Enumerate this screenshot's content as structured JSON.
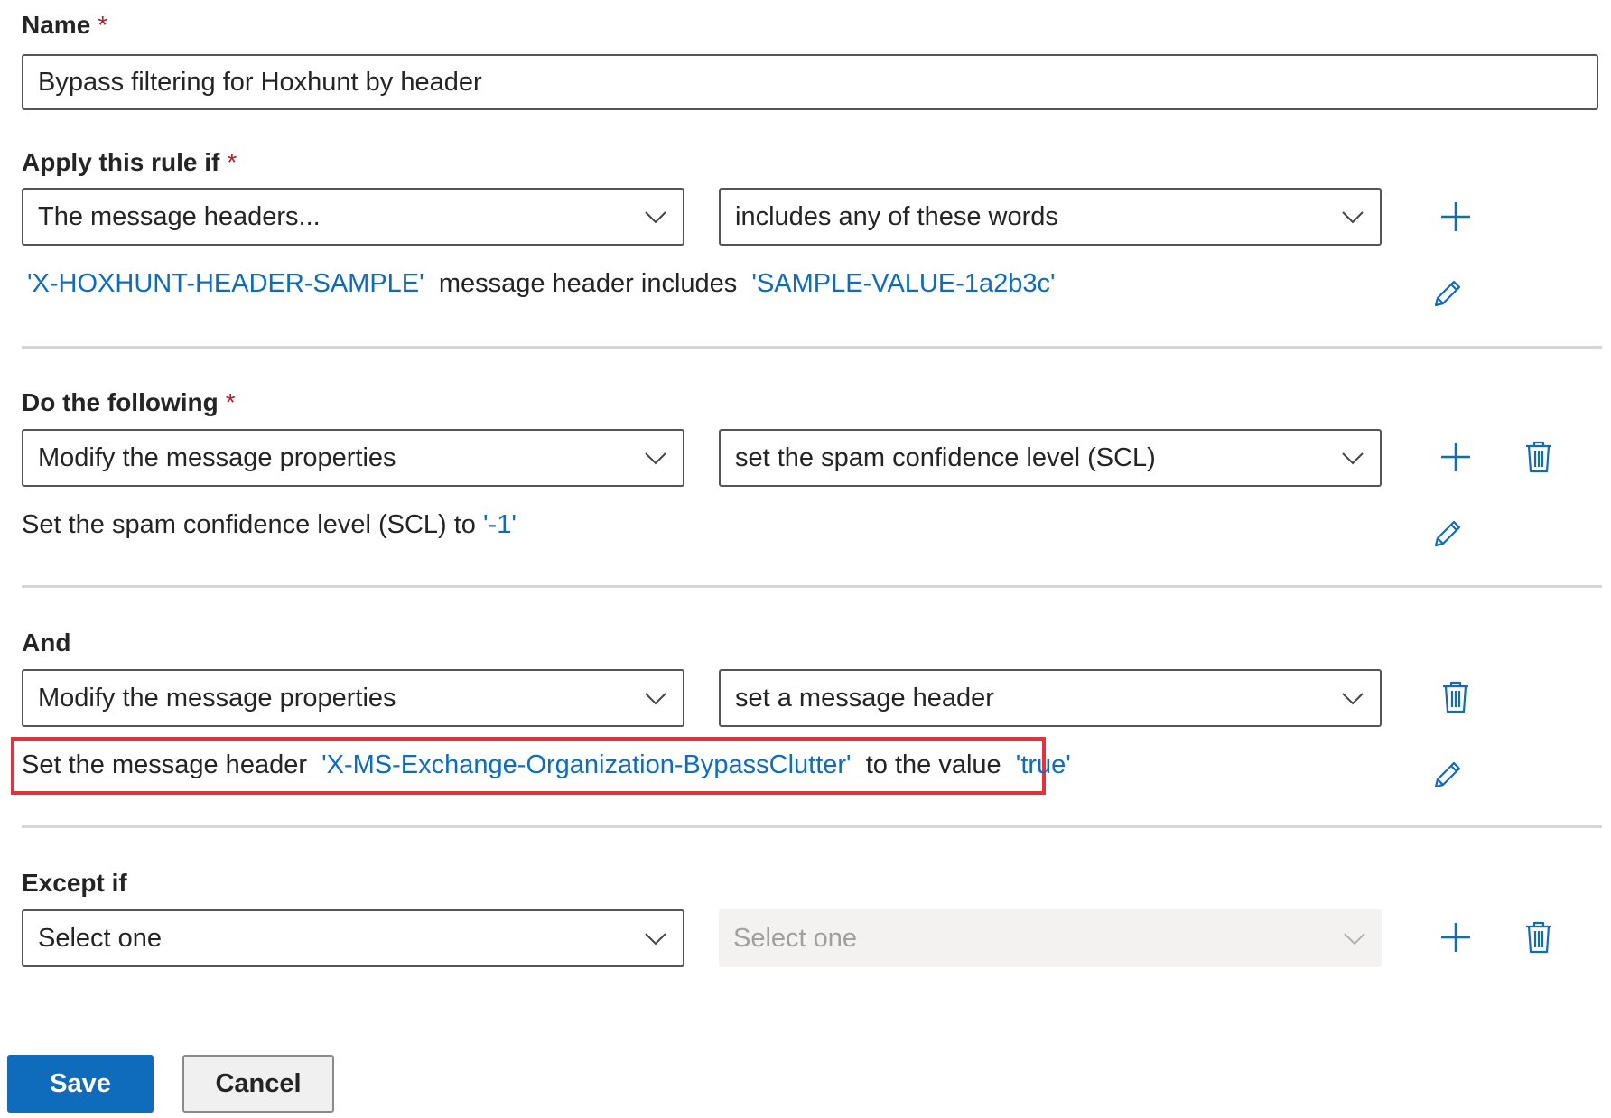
{
  "name_section": {
    "label": "Name",
    "required_mark": "*",
    "value": "Bypass filtering for Hoxhunt by header"
  },
  "apply_section": {
    "label": "Apply this rule if",
    "required_mark": "*",
    "condition_dropdown": "The message headers...",
    "operator_dropdown": "includes any of these words",
    "summary": {
      "header_name": "'X-HOXHUNT-HEADER-SAMPLE'",
      "middle": "message header includes",
      "header_value": "'SAMPLE-VALUE-1a2b3c'"
    }
  },
  "do_section": {
    "label": "Do the following",
    "required_mark": "*",
    "action_dropdown": "Modify the message properties",
    "subaction_dropdown": "set the spam confidence level (SCL)",
    "summary": {
      "prefix": "Set the spam confidence level (SCL) to",
      "value": "'-1'"
    }
  },
  "and_section": {
    "label": "And",
    "action_dropdown": "Modify the message properties",
    "subaction_dropdown": "set a message header",
    "summary": {
      "prefix": "Set the message header",
      "header_name": "'X-MS-Exchange-Organization-BypassClutter'",
      "middle": "to the value",
      "header_value": "'true'"
    }
  },
  "except_section": {
    "label": "Except if",
    "condition_dropdown": "Select one",
    "operator_dropdown": "Select one"
  },
  "buttons": {
    "save": "Save",
    "cancel": "Cancel"
  },
  "colors": {
    "accent": "#0f6cbd",
    "highlight_border": "#e8303c",
    "required": "#a4262c"
  },
  "icons": [
    "chevron-down-icon",
    "add-icon",
    "edit-icon",
    "delete-icon"
  ]
}
